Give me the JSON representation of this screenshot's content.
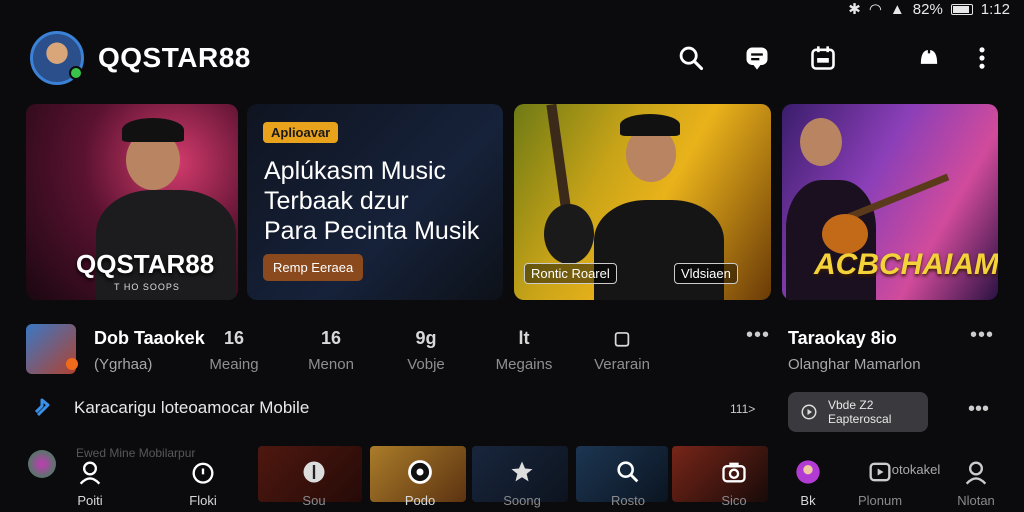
{
  "status_bar": {
    "battery": "82%",
    "time": "1:12"
  },
  "header": {
    "title": "QQSTAR88"
  },
  "banners": {
    "card1": {
      "title": "QQSTAR88",
      "subtitle": "T HO SOOPS"
    },
    "card2": {
      "chip": "Aplioavar",
      "line1": "Aplúkasm Music",
      "line2": "Terbaak dzur",
      "line3": "Para Pecinta Musik",
      "button": "Remp Eeraea"
    },
    "card3": {
      "tag1": "Rontic Roarel",
      "tag2": "Vldsiaen"
    },
    "card4": {
      "title": "ACBCHAIAMK"
    }
  },
  "info_row": {
    "artist": "Dob Taaokek",
    "artist_sub": "(Ygrhaa)",
    "stats": [
      {
        "value": "16",
        "label": "Meaing"
      },
      {
        "value": "16",
        "label": "Menon"
      },
      {
        "value": "9g",
        "label": "Vobje"
      },
      {
        "value": "lt",
        "label": "Megains"
      },
      {
        "value": "▢",
        "label": "Verarain"
      }
    ],
    "right_title": "Taraokay 8io",
    "right_sub": "Olanghar Mamarlon"
  },
  "mobile_row": {
    "text": "Karacarigu loteoamocar Mobile",
    "count": "111>",
    "pill_line1": "Vbde Z2",
    "pill_line2": "Eapteroscal"
  },
  "behind_text": "Ewed Mine Mobilarpur",
  "nav": [
    {
      "label": "Poiti",
      "icon": "person-icon"
    },
    {
      "label": "Floki",
      "icon": "timer-icon"
    },
    {
      "label": "Sou",
      "icon": "guitar-pick-icon"
    },
    {
      "label": "Podo",
      "icon": "record-icon"
    },
    {
      "label": "Soong",
      "icon": "star-icon"
    },
    {
      "label": "Rosto",
      "icon": "search-icon"
    },
    {
      "label": "Sico",
      "icon": "camera-icon"
    },
    {
      "label": "Bk",
      "icon": "profile-bubble-icon"
    },
    {
      "label": "Plonum",
      "icon": "playlist-icon"
    },
    {
      "label": "Nlotan",
      "icon": "user-icon"
    }
  ],
  "nav_extra": "otokakel"
}
